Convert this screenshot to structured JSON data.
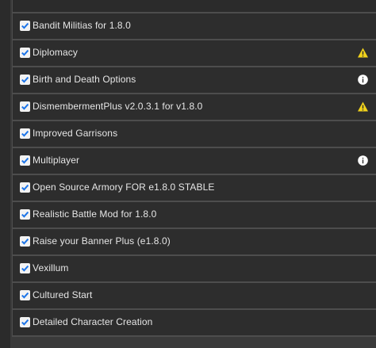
{
  "mods": [
    {
      "label": "Bandit Militias for 1.8.0",
      "checked": true,
      "status_icon": "none"
    },
    {
      "label": "Diplomacy",
      "checked": true,
      "status_icon": "warning-icon"
    },
    {
      "label": "Birth and Death Options",
      "checked": true,
      "status_icon": "info-icon"
    },
    {
      "label": "DismembermentPlus v2.0.3.1 for v1.8.0",
      "checked": true,
      "status_icon": "warning-icon"
    },
    {
      "label": "Improved Garrisons",
      "checked": true,
      "status_icon": "none"
    },
    {
      "label": "Multiplayer",
      "checked": true,
      "status_icon": "info-icon"
    },
    {
      "label": "Open Source Armory FOR e1.8.0 STABLE",
      "checked": true,
      "status_icon": "none"
    },
    {
      "label": "Realistic Battle Mod for 1.8.0",
      "checked": true,
      "status_icon": "none"
    },
    {
      "label": "Raise your Banner Plus (e1.8.0)",
      "checked": true,
      "status_icon": "none"
    },
    {
      "label": "Vexillum",
      "checked": true,
      "status_icon": "none"
    },
    {
      "label": "Cultured Start",
      "checked": true,
      "status_icon": "none"
    },
    {
      "label": "Detailed Character Creation",
      "checked": true,
      "status_icon": "none"
    }
  ],
  "colors": {
    "checkbox_check": "#1a73e8",
    "warning": "#f2d31b",
    "info": "#ffffff"
  }
}
